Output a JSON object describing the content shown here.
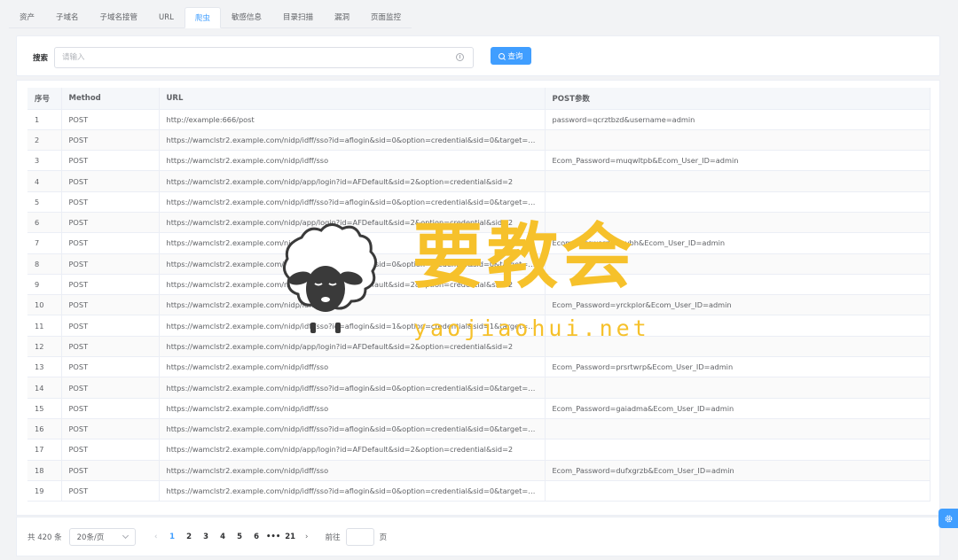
{
  "tabs": [
    {
      "label": "资产",
      "active": false
    },
    {
      "label": "子域名",
      "active": false
    },
    {
      "label": "子域名接管",
      "active": false
    },
    {
      "label": "URL",
      "active": false
    },
    {
      "label": "爬虫",
      "active": true
    },
    {
      "label": "敏感信息",
      "active": false
    },
    {
      "label": "目录扫描",
      "active": false
    },
    {
      "label": "漏洞",
      "active": false
    },
    {
      "label": "页面监控",
      "active": false
    }
  ],
  "search": {
    "label": "搜索",
    "placeholder": "请输入",
    "button_label": "查询"
  },
  "table": {
    "columns": [
      "序号",
      "Method",
      "URL",
      "POST参数"
    ],
    "rows": [
      [
        "1",
        "POST",
        "http://example:666/post",
        "password=qcrztbzd&username=admin"
      ],
      [
        "2",
        "POST",
        "https://wamclstr2.example.com/nidp/idff/sso?id=aflogin&sid=0&option=credential&sid=0&target=https%3A%2F...",
        ""
      ],
      [
        "3",
        "POST",
        "https://wamclstr2.example.com/nidp/idff/sso",
        "Ecom_Password=muqwltpb&Ecom_User_ID=admin"
      ],
      [
        "4",
        "POST",
        "https://wamclstr2.example.com/nidp/app/login?id=AFDefault&sid=2&option=credential&sid=2",
        ""
      ],
      [
        "5",
        "POST",
        "https://wamclstr2.example.com/nidp/idff/sso?id=aflogin&sid=0&option=credential&sid=0&target=https%3A%2F...",
        ""
      ],
      [
        "6",
        "POST",
        "https://wamclstr2.example.com/nidp/app/login?id=AFDefault&sid=2&option=credential&sid=2",
        ""
      ],
      [
        "7",
        "POST",
        "https://wamclstr2.example.com/nidp/idff/sso",
        "Ecom_Password=fluvbh&Ecom_User_ID=admin"
      ],
      [
        "8",
        "POST",
        "https://wamclstr2.example.com/nidp/idff/sso?id=aflogin&sid=0&option=credential&sid=0&target=https%3A%2F...",
        ""
      ],
      [
        "9",
        "POST",
        "https://wamclstr2.example.com/nidp/app/login?id=AFDefault&sid=2&option=credential&sid=2",
        ""
      ],
      [
        "10",
        "POST",
        "https://wamclstr2.example.com/nidp/idff/sso",
        "Ecom_Password=yrckplor&Ecom_User_ID=admin"
      ],
      [
        "11",
        "POST",
        "https://wamclstr2.example.com/nidp/idff/sso?id=aflogin&sid=1&option=credential&sid=1&target=https%3A%2F...",
        ""
      ],
      [
        "12",
        "POST",
        "https://wamclstr2.example.com/nidp/app/login?id=AFDefault&sid=2&option=credential&sid=2",
        ""
      ],
      [
        "13",
        "POST",
        "https://wamclstr2.example.com/nidp/idff/sso",
        "Ecom_Password=prsrtwrp&Ecom_User_ID=admin"
      ],
      [
        "14",
        "POST",
        "https://wamclstr2.example.com/nidp/idff/sso?id=aflogin&sid=0&option=credential&sid=0&target=https%3A%2F...",
        ""
      ],
      [
        "15",
        "POST",
        "https://wamclstr2.example.com/nidp/idff/sso",
        "Ecom_Password=gaiadma&Ecom_User_ID=admin"
      ],
      [
        "16",
        "POST",
        "https://wamclstr2.example.com/nidp/idff/sso?id=aflogin&sid=0&option=credential&sid=0&target=https%3A%2F...",
        ""
      ],
      [
        "17",
        "POST",
        "https://wamclstr2.example.com/nidp/app/login?id=AFDefault&sid=2&option=credential&sid=2",
        ""
      ],
      [
        "18",
        "POST",
        "https://wamclstr2.example.com/nidp/idff/sso",
        "Ecom_Password=dufxgrzb&Ecom_User_ID=admin"
      ],
      [
        "19",
        "POST",
        "https://wamclstr2.example.com/nidp/idff/sso?id=aflogin&sid=0&option=credential&sid=0&target=https%3A%2F...",
        ""
      ]
    ]
  },
  "pagination": {
    "total": "共 420 条",
    "page_size": "20条/页",
    "pages": [
      "1",
      "2",
      "3",
      "4",
      "5",
      "6",
      "•••",
      "21"
    ],
    "current": "1",
    "jump_label": "前往",
    "jump_unit": "页"
  },
  "watermark": {
    "brand": "要教会",
    "url": "yaojiaohui.net"
  },
  "colors": {
    "primary": "#409eff",
    "watermark": "#f6c12b"
  },
  "icons": {
    "search_button": "search-icon",
    "clear": "clock-icon",
    "floating": "gear-icon",
    "prev": "chevron-left-icon",
    "next": "chevron-right-icon"
  }
}
